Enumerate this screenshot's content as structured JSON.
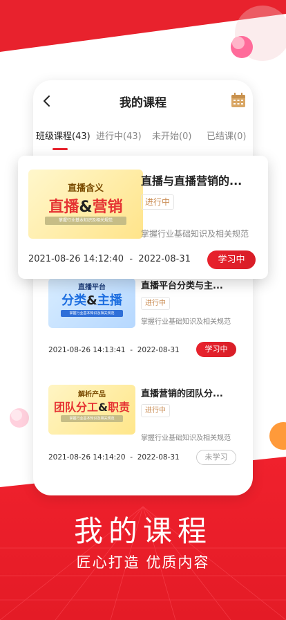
{
  "nav": {
    "title": "我的课程"
  },
  "tabs": [
    {
      "label": "班级课程(43)"
    },
    {
      "label": "进行中(43)"
    },
    {
      "label": "未开始(0)"
    },
    {
      "label": "已结课(0)"
    }
  ],
  "courses": [
    {
      "thumb_line1": "直播含义",
      "thumb_line2a": "直播",
      "thumb_amp": "&",
      "thumb_line2b": "营销",
      "thumb_banner": "掌握行业基本知识及相关规范",
      "title": "直播与直播营销的...",
      "status": "进行中",
      "desc": "掌握行业基础知识及相关规范",
      "start": "2021-08-26 14:12:40",
      "sep": "-",
      "end": "2022-08-31",
      "button": "学习中"
    },
    {
      "thumb_line1": "直播平台",
      "thumb_line2a": "分类",
      "thumb_amp": "&",
      "thumb_line2b": "主播",
      "thumb_banner": "掌握行业基本知识及相关规范",
      "title": "直播平台分类与主...",
      "status": "进行中",
      "desc": "掌握行业基础知识及相关规范",
      "start": "2021-08-26 14:13:41",
      "sep": "-",
      "end": "2022-08-31",
      "button": "学习中"
    },
    {
      "thumb_line1": "解析产品",
      "thumb_line2a": "团队分工",
      "thumb_amp": "&",
      "thumb_line2b": "职责",
      "thumb_banner": "掌握行业基本知识及相关规范",
      "title": "直播营销的团队分...",
      "status": "进行中",
      "desc": "掌握行业基础知识及相关规范",
      "start": "2021-08-26 14:14:20",
      "sep": "-",
      "end": "2022-08-31",
      "button": "未学习"
    }
  ],
  "promo": {
    "title": "我的课程",
    "subtitle": "匠心打造  优质内容"
  },
  "colors": {
    "accent": "#e8222d",
    "tag_text": "#c98b52"
  }
}
